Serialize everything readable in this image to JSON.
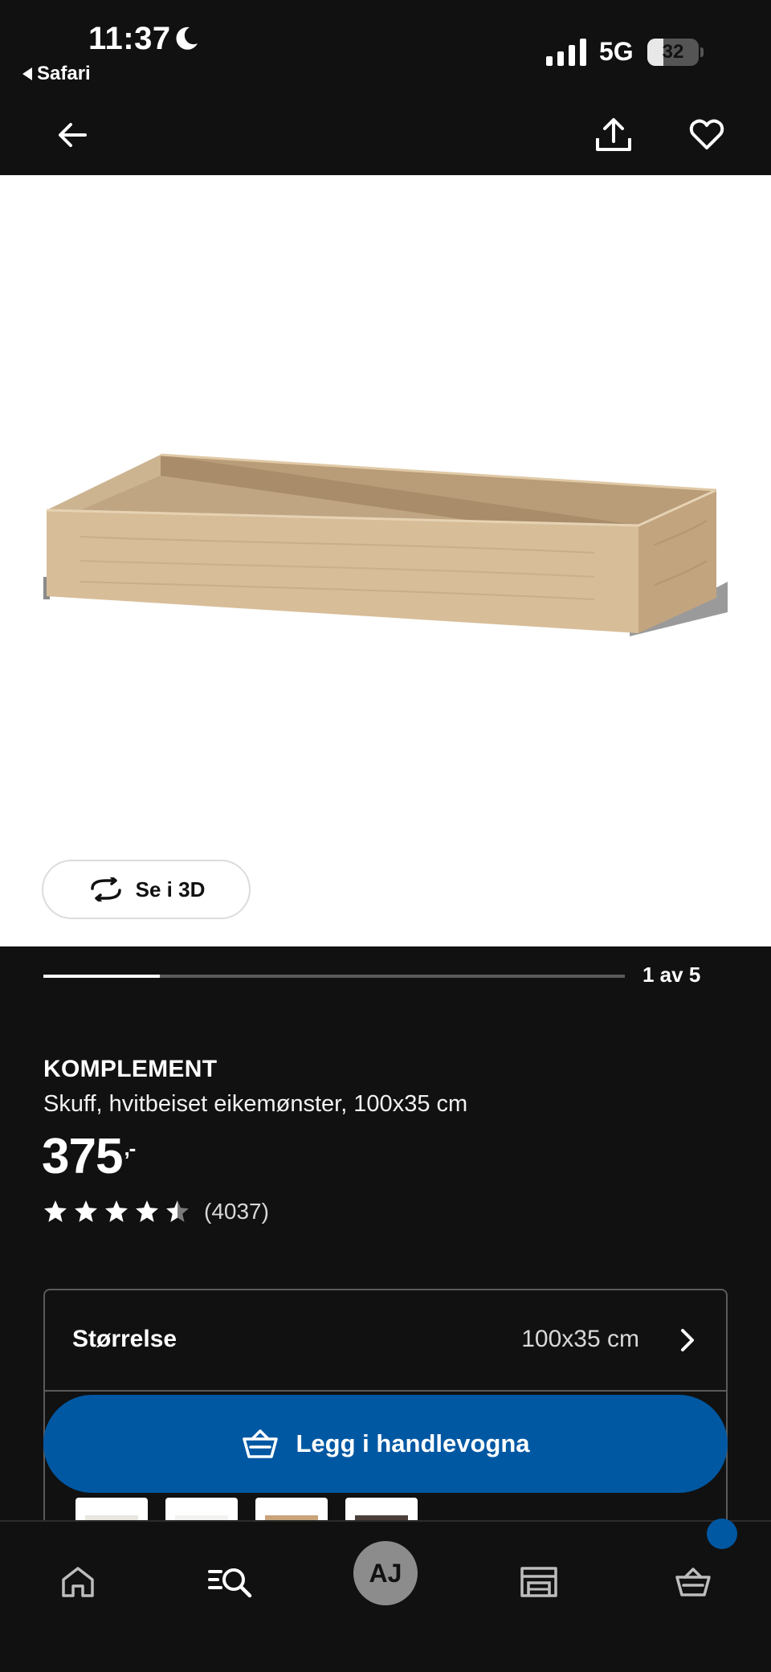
{
  "status_bar": {
    "time": "11:37",
    "back_app": "Safari",
    "network": "5G",
    "battery_level": "32",
    "battery_fraction": 0.32
  },
  "header": {
    "icons": [
      "back-arrow-icon",
      "share-icon",
      "heart-icon"
    ]
  },
  "media": {
    "view_3d_label": "Se i 3D",
    "carousel_label": "1 av 5",
    "carousel_current": 1,
    "carousel_total": 5
  },
  "product": {
    "brand": "KOMPLEMENT",
    "description": "Skuff, hvitbeiset eikemønster, 100x35 cm",
    "price": "375",
    "price_suffix": ",-",
    "rating_value": 4.5,
    "rating_max": 5,
    "review_count": "(4037)"
  },
  "size_selector": {
    "label": "Størrelse",
    "value": "100x35 cm"
  },
  "swatches": [
    {
      "color": "#e9e6e0"
    },
    {
      "color": "#f2f2f0"
    },
    {
      "color": "#c9a37a"
    },
    {
      "color": "#4a3f3a"
    }
  ],
  "cart_button": {
    "label": "Legg i handlevogna"
  },
  "bottom_nav": {
    "avatar_initials": "AJ",
    "items": [
      "home-icon",
      "search-icon",
      "avatar",
      "store-icon",
      "cart-icon"
    ]
  },
  "colors": {
    "background": "#111111",
    "brand_blue": "#0058a3",
    "wood_light": "#d8bc94",
    "wood_dark": "#c2a27a"
  }
}
